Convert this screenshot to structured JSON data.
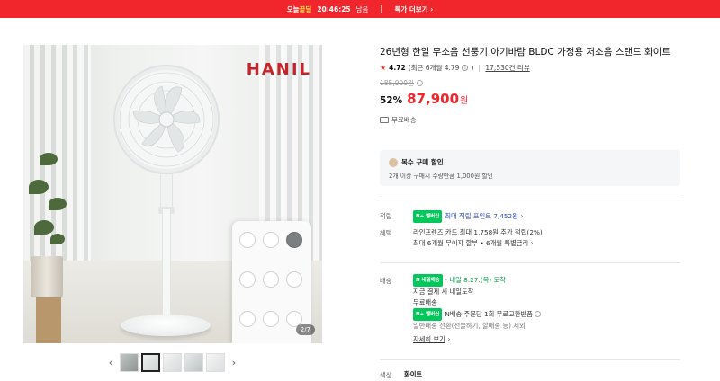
{
  "topbar": {
    "badge_pre": "오늘",
    "badge_hl": "끝딜",
    "timer": "20:46:25",
    "timer_suffix": "남음",
    "more": "특가 더보기",
    "more_chevron": "›",
    "bg_color": "#f0262c"
  },
  "gallery": {
    "brand": "HANIL",
    "counter": "2/7",
    "prev_icon": "‹",
    "next_icon": "›",
    "thumbs": [
      "thumb-1",
      "thumb-2",
      "thumb-3",
      "thumb-4",
      "thumb-5"
    ],
    "active_thumb": 2
  },
  "product": {
    "title": "26년형 한일 무소음 선풍기 아기바람 BLDC 가정용 저소음 스탠드 화이트",
    "rating": "4.72",
    "rating_recent": "(최근 6개월 4.79",
    "rating_recent_close": ")",
    "reviews": "17,530건 리뷰",
    "original_price": "185,000원",
    "discount": "52%",
    "price": "87,900",
    "price_unit": "원",
    "free_shipping": "무료배송"
  },
  "multi_buy": {
    "title": "복수 구매 할인",
    "desc": "2개 이상 구매시 수량만큼 1,000원 할인"
  },
  "benefits": {
    "points_label": "적립",
    "npay_badge": "N+ 멤버십",
    "points_text": "최대 적립 포인트 7,452원",
    "perks_label": "혜택",
    "perk1": "라인프렌즈 카드 최대 1,758원 추가 적립(2%)",
    "perk2": "최대 6개월 무이자 할부 • 6개월 특별금리"
  },
  "delivery": {
    "label": "배송",
    "badge": "N 내일배송",
    "eta": "· 내일 8.27.(목) 도착",
    "line1": "지금 결제 시 내일도착",
    "line2": "무료배송",
    "npay_badge": "N+ 멤버십",
    "line3": "N배송 주문당 1회 무료교환반품",
    "line4": "일반배송 전환(선물하기, 할배송 등) 제외",
    "details": "자세히 보기"
  },
  "option": {
    "label": "색상",
    "value": "화이트"
  }
}
